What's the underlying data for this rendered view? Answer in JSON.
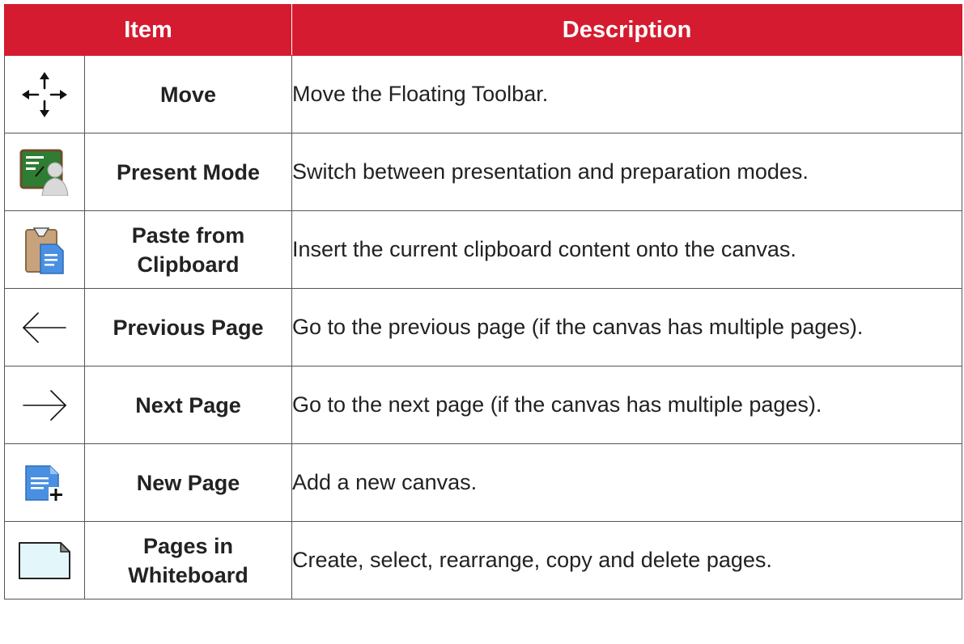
{
  "table": {
    "headers": {
      "item": "Item",
      "description": "Description"
    },
    "rows": [
      {
        "icon": "move-arrows-icon",
        "item": "Move",
        "description": "Move the Floating Toolbar."
      },
      {
        "icon": "present-mode-icon",
        "item": "Present Mode",
        "description": "Switch between presentation and preparation modes."
      },
      {
        "icon": "paste-clipboard-icon",
        "item": "Paste from Clipboard",
        "description": "Insert the current clipboard content onto the canvas."
      },
      {
        "icon": "arrow-left-icon",
        "item": "Previous Page",
        "description": "Go to the previous page (if the canvas has multiple pages)."
      },
      {
        "icon": "arrow-right-icon",
        "item": "Next Page",
        "description": "Go to the next page (if the canvas has multiple pages)."
      },
      {
        "icon": "new-page-icon",
        "item": "New Page",
        "description": "Add a new canvas."
      },
      {
        "icon": "pages-in-whiteboard-icon",
        "item": "Pages in Whiteboard",
        "description": "Create, select, rearrange, copy and delete pages."
      }
    ]
  },
  "colors": {
    "header_bg": "#d51b2f",
    "header_text": "#ffffff",
    "border": "#555555",
    "text": "#222222"
  }
}
